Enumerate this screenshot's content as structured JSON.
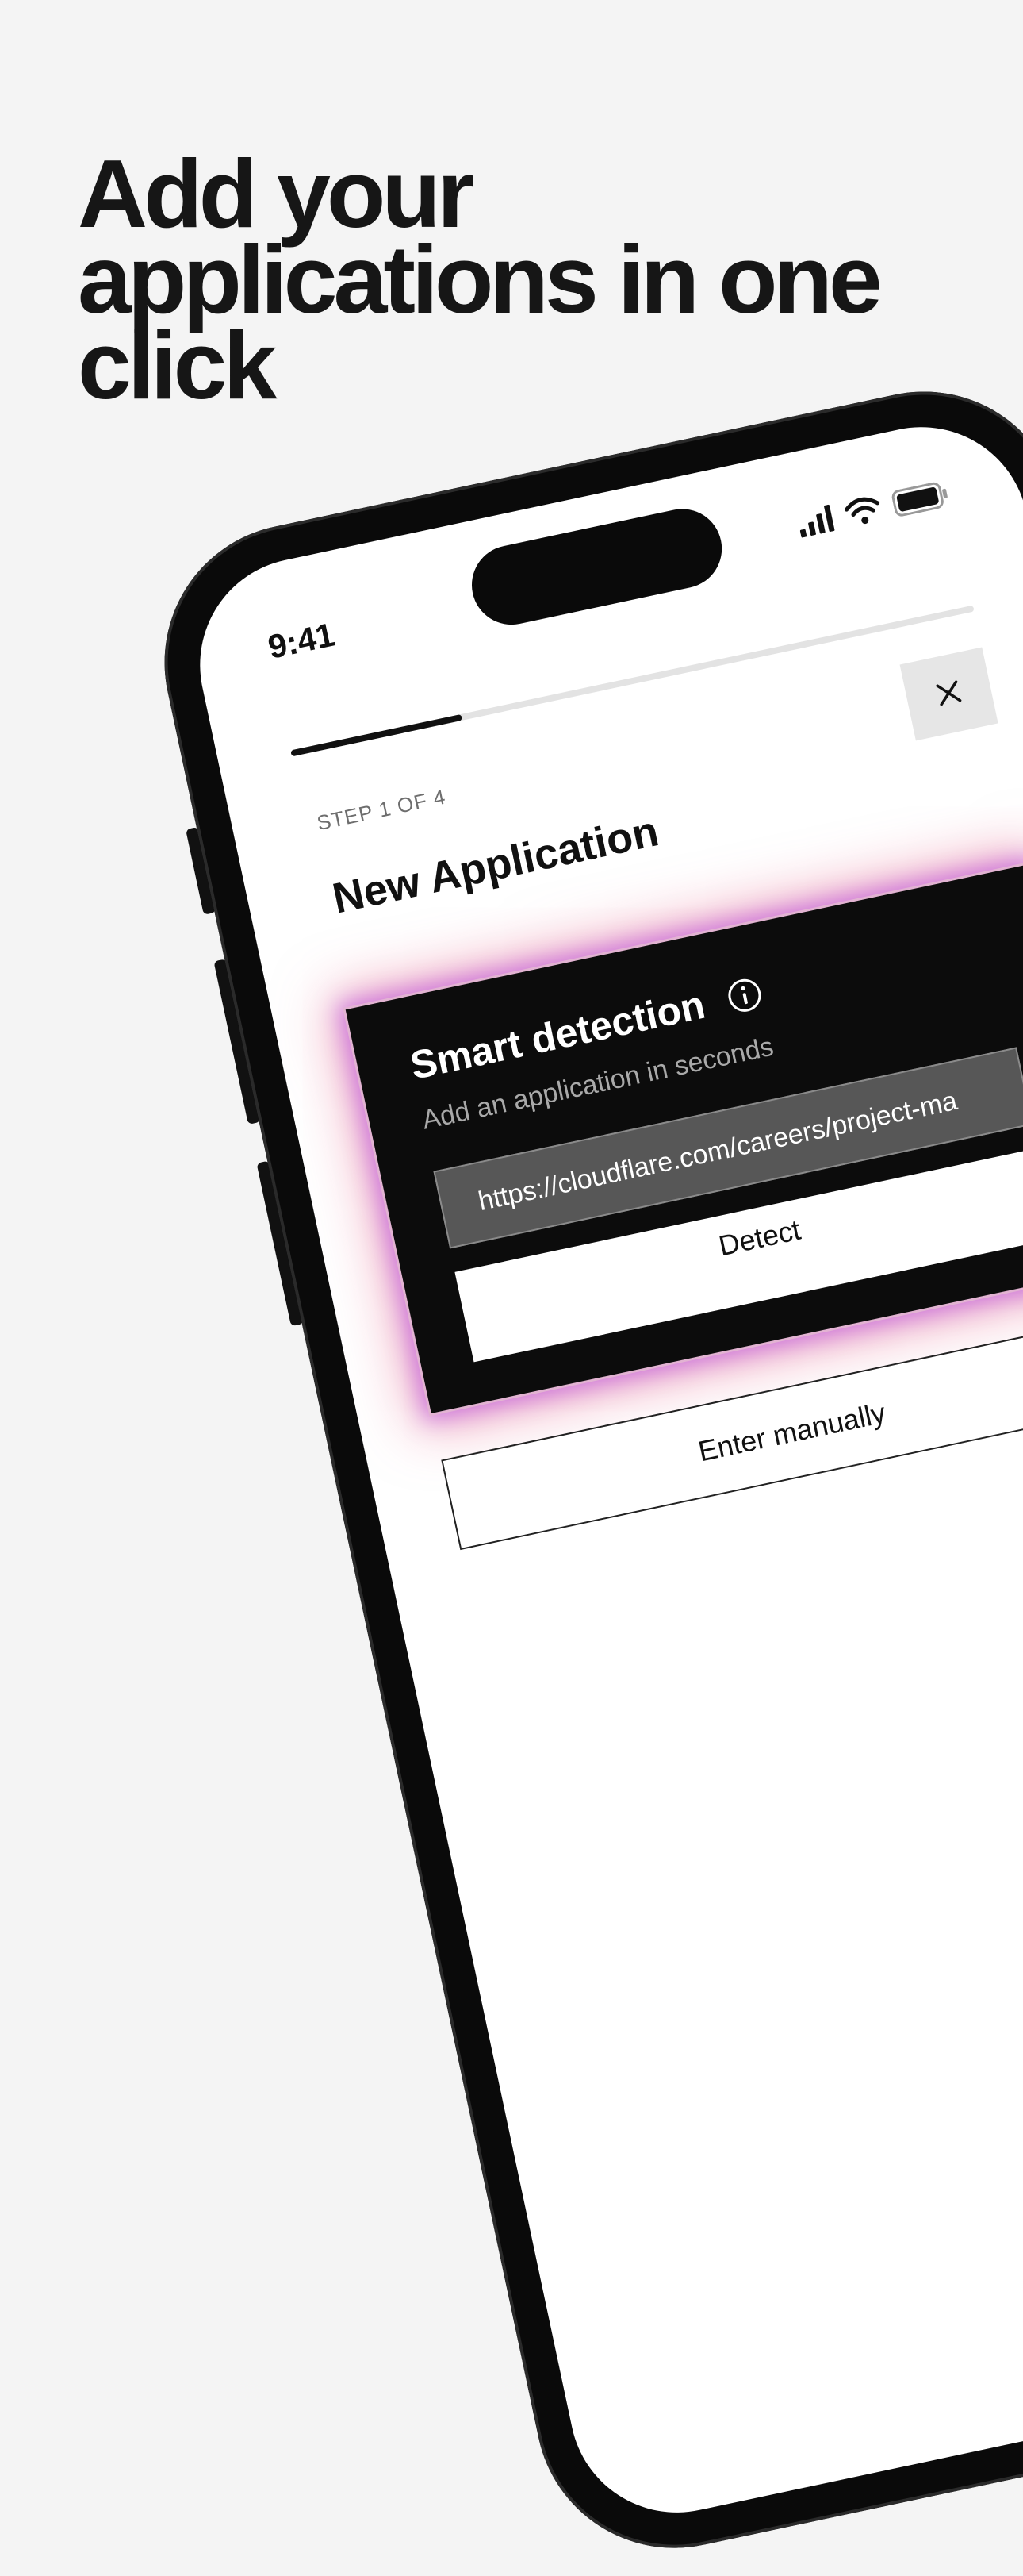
{
  "headline": "Add your applications in one click",
  "status_bar": {
    "time": "9:41",
    "icons": [
      "cellular-signal-icon",
      "wifi-icon",
      "battery-icon"
    ]
  },
  "progress": {
    "current_step": 1,
    "total_steps": 4,
    "fraction": 0.25
  },
  "screen": {
    "step_label": "STEP 1 OF 4",
    "title": "New Application",
    "close_icon": "close-icon"
  },
  "smart_detection": {
    "title": "Smart detection",
    "info_icon": "info-icon",
    "subtitle": "Add an application in seconds",
    "url_value": "https://cloudflare.com/careers/project-ma",
    "detect_label": "Detect"
  },
  "manual": {
    "label": "Enter manually"
  },
  "colors": {
    "background": "#f4f4f4",
    "headline": "#161616",
    "card": "#0c0c0c",
    "glow_purple": "#c468e0",
    "glow_pink": "#e25882"
  }
}
